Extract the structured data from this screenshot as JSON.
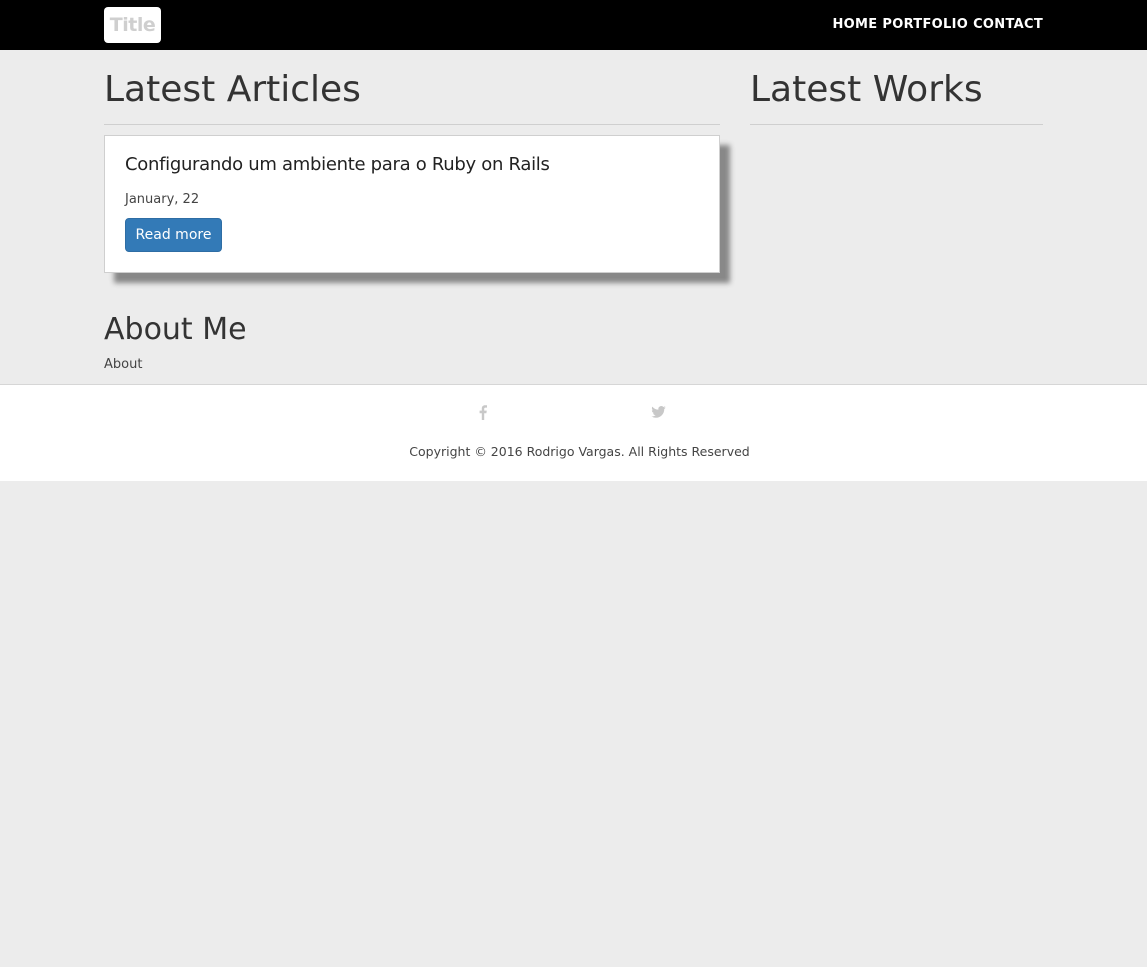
{
  "navbar": {
    "brand": "Title",
    "links": [
      "HOME",
      "PORTFOLIO",
      "CONTACT"
    ]
  },
  "latest_articles": {
    "heading": "Latest Articles",
    "articles": [
      {
        "title": "Configurando um ambiente para o Ruby on Rails",
        "date": "January, 22",
        "button_label": "Read more"
      }
    ]
  },
  "latest_works": {
    "heading": "Latest Works"
  },
  "about": {
    "heading": "About Me",
    "text": "About"
  },
  "footer": {
    "social_icons": [
      "facebook-icon",
      "twitter-icon"
    ],
    "copyright": "Copyright © 2016 Rodrigo Vargas. All Rights Reserved"
  },
  "colors": {
    "navbar_bg": "#000000",
    "page_bg": "#ececec",
    "button_primary": "#337ab7",
    "icon_gray": "#c8c8c8"
  }
}
